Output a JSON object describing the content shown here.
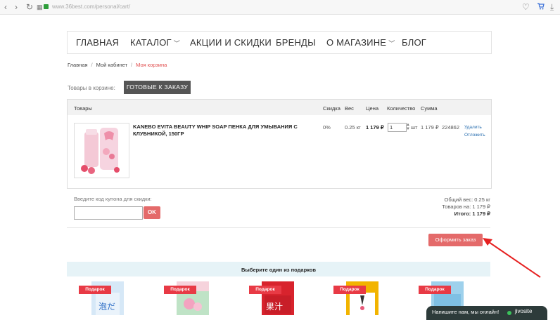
{
  "browser": {
    "url": "www.36best.com/personal/cart/"
  },
  "nav": {
    "items": [
      {
        "label": "ГЛАВНАЯ"
      },
      {
        "label": "КАТАЛОГ"
      },
      {
        "label": "АКЦИИ И СКИДКИ"
      },
      {
        "label": "БРЕНДЫ"
      },
      {
        "label": "О МАГАЗИНЕ"
      },
      {
        "label": "БЛОГ"
      }
    ]
  },
  "breadcrumb": {
    "home": "Главная",
    "cabinet": "Мой кабинет",
    "current": "Моя корзина"
  },
  "cart": {
    "label": "Товары в корзине:",
    "ready_button": "ГОТОВЫЕ К ЗАКАЗУ",
    "headers": {
      "goods": "Товары",
      "discount": "Скидка",
      "weight": "Вес",
      "price": "Цена",
      "quantity": "Количество",
      "sum": "Сумма"
    },
    "item": {
      "name": "KANEBO EVITA BEAUTY WHIP SOAP ПЕНКА ДЛЯ УМЫВАНИЯ С КЛУБНИКОЙ, 150ГР",
      "discount": "0%",
      "weight": "0.25 кг",
      "price": "1 179 ₽",
      "quantity": "1",
      "unit": "шт",
      "sum": "1 179 ₽",
      "id": "224862",
      "delete": "Удалить",
      "postpone": "Отложить"
    }
  },
  "coupon": {
    "label": "Введите код купона для скидки:",
    "value": "",
    "ok": "OK"
  },
  "summary": {
    "total_weight": "Общий вес:  0.25 кг",
    "goods_sum": "Товаров на: 1 179 ₽",
    "total": "Итого: 1 179 ₽"
  },
  "checkout_button": "Оформить заказ",
  "gifts": {
    "title": "Выберите один из подарков",
    "ribbon": "Подарок",
    "items": [
      {
        "color": "#d6e8f7"
      },
      {
        "color": "#f6d3dc"
      },
      {
        "color": "#d8232d"
      },
      {
        "color": "#f2b400"
      },
      {
        "color": "#9ed1ec"
      }
    ]
  },
  "chat": {
    "text": "Напишите нам, мы онлайн!",
    "brand": "jivosite"
  },
  "colors": {
    "accent": "#e46a6a",
    "dark_button": "#555555",
    "breadcrumb_current": "#e04b4b",
    "link": "#2a6fb0"
  }
}
